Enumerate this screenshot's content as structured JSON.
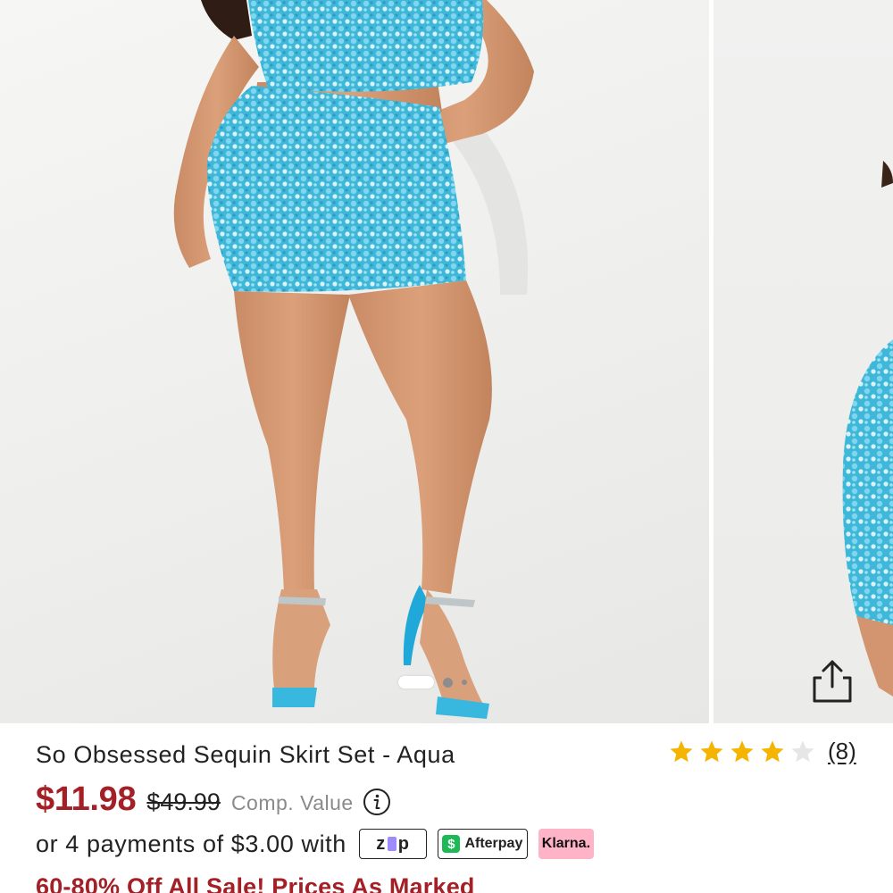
{
  "product": {
    "title": "So Obsessed Sequin Skirt Set - Aqua",
    "rating_value": 4,
    "rating_max": 5,
    "review_count": "(8)",
    "sale_price": "$11.98",
    "original_price": "$49.99",
    "comp_value_label": "Comp. Value"
  },
  "payments": {
    "text": "or 4 payments of $3.00 with",
    "providers": {
      "zip": "zip",
      "afterpay": "Afterpay",
      "klarna": "Klarna."
    }
  },
  "promo": "60-80% Off All Sale! Prices As Marked",
  "carousel": {
    "slide_count": 3,
    "active_index": 0
  },
  "icons": {
    "share": "share-icon",
    "info": "info-icon",
    "star": "star-icon"
  },
  "colors": {
    "sale_price": "#a32027",
    "star_filled": "#f4b400",
    "star_empty": "#e6e6e6",
    "skirt_aqua": "#3fb7d8",
    "klarna_pink": "#ffb3c7",
    "afterpay_green": "#1db954"
  }
}
